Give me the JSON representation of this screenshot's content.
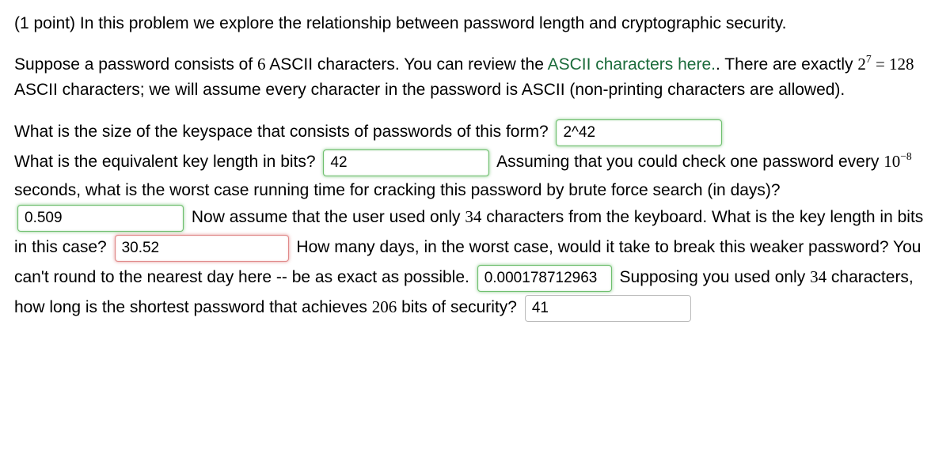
{
  "points": "(1 point)",
  "intro": "In this problem we explore the relationship between password length and cryptographic security.",
  "p2_a": "Suppose a password consists of ",
  "p2_n1": "6",
  "p2_b": " ASCII characters. You can review the ",
  "p2_link": "ASCII characters here.",
  "p2_c": ". There are exactly ",
  "p2_base": "2",
  "p2_exp": "7",
  "p2_eq": " = ",
  "p2_n2": "128",
  "p2_d": " ASCII characters; we will assume every character in the password is ASCII (non-printing characters are allowed).",
  "q1": "What is the size of the keyspace that consists of passwords of this form?",
  "a1": "2^42",
  "q2": "What is the equivalent key length in bits?",
  "a2": "42",
  "q3a": "Assuming that you could check one password every ",
  "q3_base": "10",
  "q3_exp": "−8",
  "q3b": " seconds, what is the worst case running time for cracking this password by brute force search (in days)?",
  "a3": "0.509",
  "q4a": "Now assume that the user used only ",
  "q4_n": "34",
  "q4b": " characters from the keyboard. What is the key length in bits in this case?",
  "a4": "30.52",
  "q5": "How many days, in the worst case, would it take to break this weaker password? You can't round to the nearest day here -- be as exact as possible.",
  "a5": "0.000178712963",
  "q6a": "Supposing you used only ",
  "q6_n1": "34",
  "q6b": " characters, how long is the shortest password that achieves ",
  "q6_n2": "206",
  "q6c": " bits of security?",
  "a6": "41"
}
